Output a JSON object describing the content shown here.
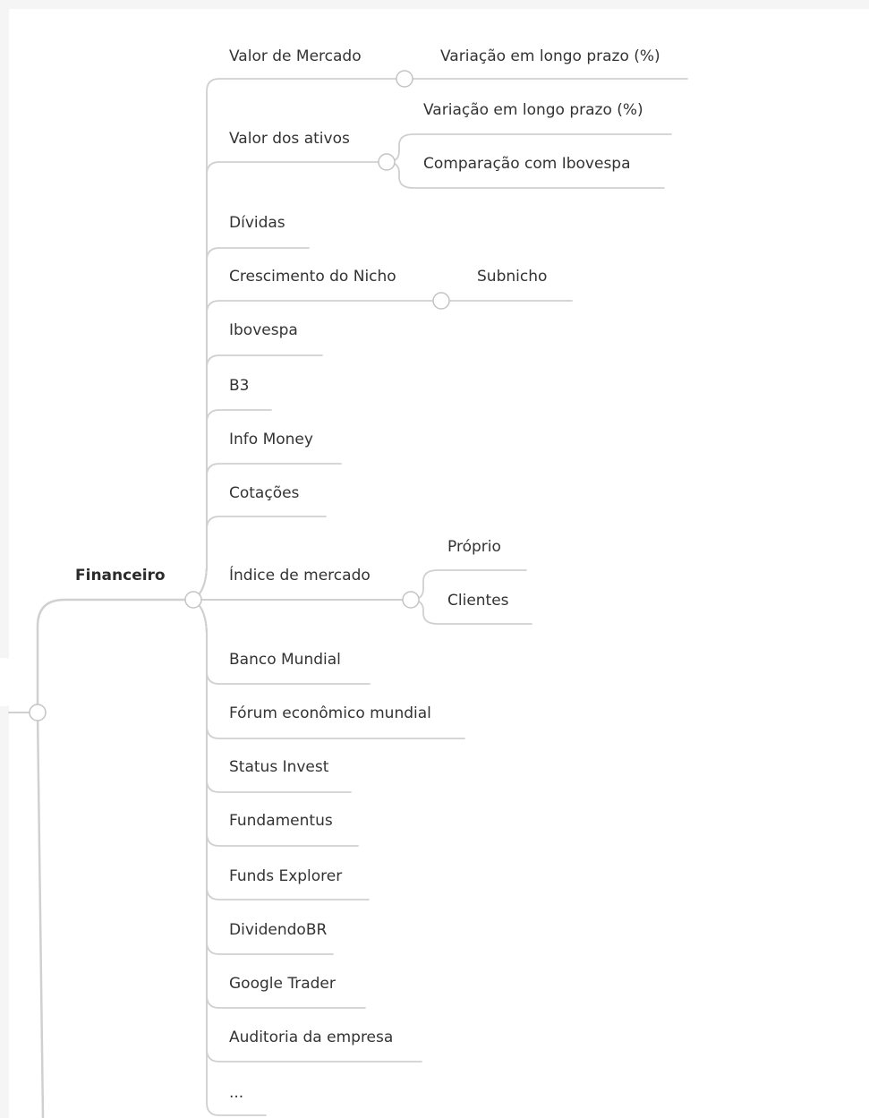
{
  "mindmap": {
    "branch": "Financeiro",
    "topics": [
      {
        "label": "Valor de Mercado",
        "children": [
          "Variação em longo prazo (%)"
        ]
      },
      {
        "label": "Valor dos ativos",
        "children": [
          "Variação em longo prazo (%)",
          "Comparação com Ibovespa"
        ]
      },
      {
        "label": "Dívidas",
        "children": []
      },
      {
        "label": "Crescimento do Nicho",
        "children": [
          "Subnicho"
        ]
      },
      {
        "label": "Ibovespa",
        "children": []
      },
      {
        "label": "B3",
        "children": []
      },
      {
        "label": "Info Money",
        "children": []
      },
      {
        "label": "Cotações",
        "children": []
      },
      {
        "label": "Índice de mercado",
        "children": [
          "Próprio",
          "Clientes"
        ]
      },
      {
        "label": "Banco Mundial",
        "children": []
      },
      {
        "label": "Fórum econômico mundial",
        "children": []
      },
      {
        "label": "Status Invest",
        "children": []
      },
      {
        "label": "Fundamentus",
        "children": []
      },
      {
        "label": "Funds Explorer",
        "children": []
      },
      {
        "label": "DividendoBR",
        "children": []
      },
      {
        "label": "Google Trader",
        "children": []
      },
      {
        "label": "Auditoria da empresa",
        "children": []
      },
      {
        "label": "...",
        "children": []
      }
    ]
  },
  "colors": {
    "connector": "#d0d0d0",
    "node_fill": "#ffffff",
    "node_stroke": "#c4c4c4",
    "text": "#333333"
  }
}
